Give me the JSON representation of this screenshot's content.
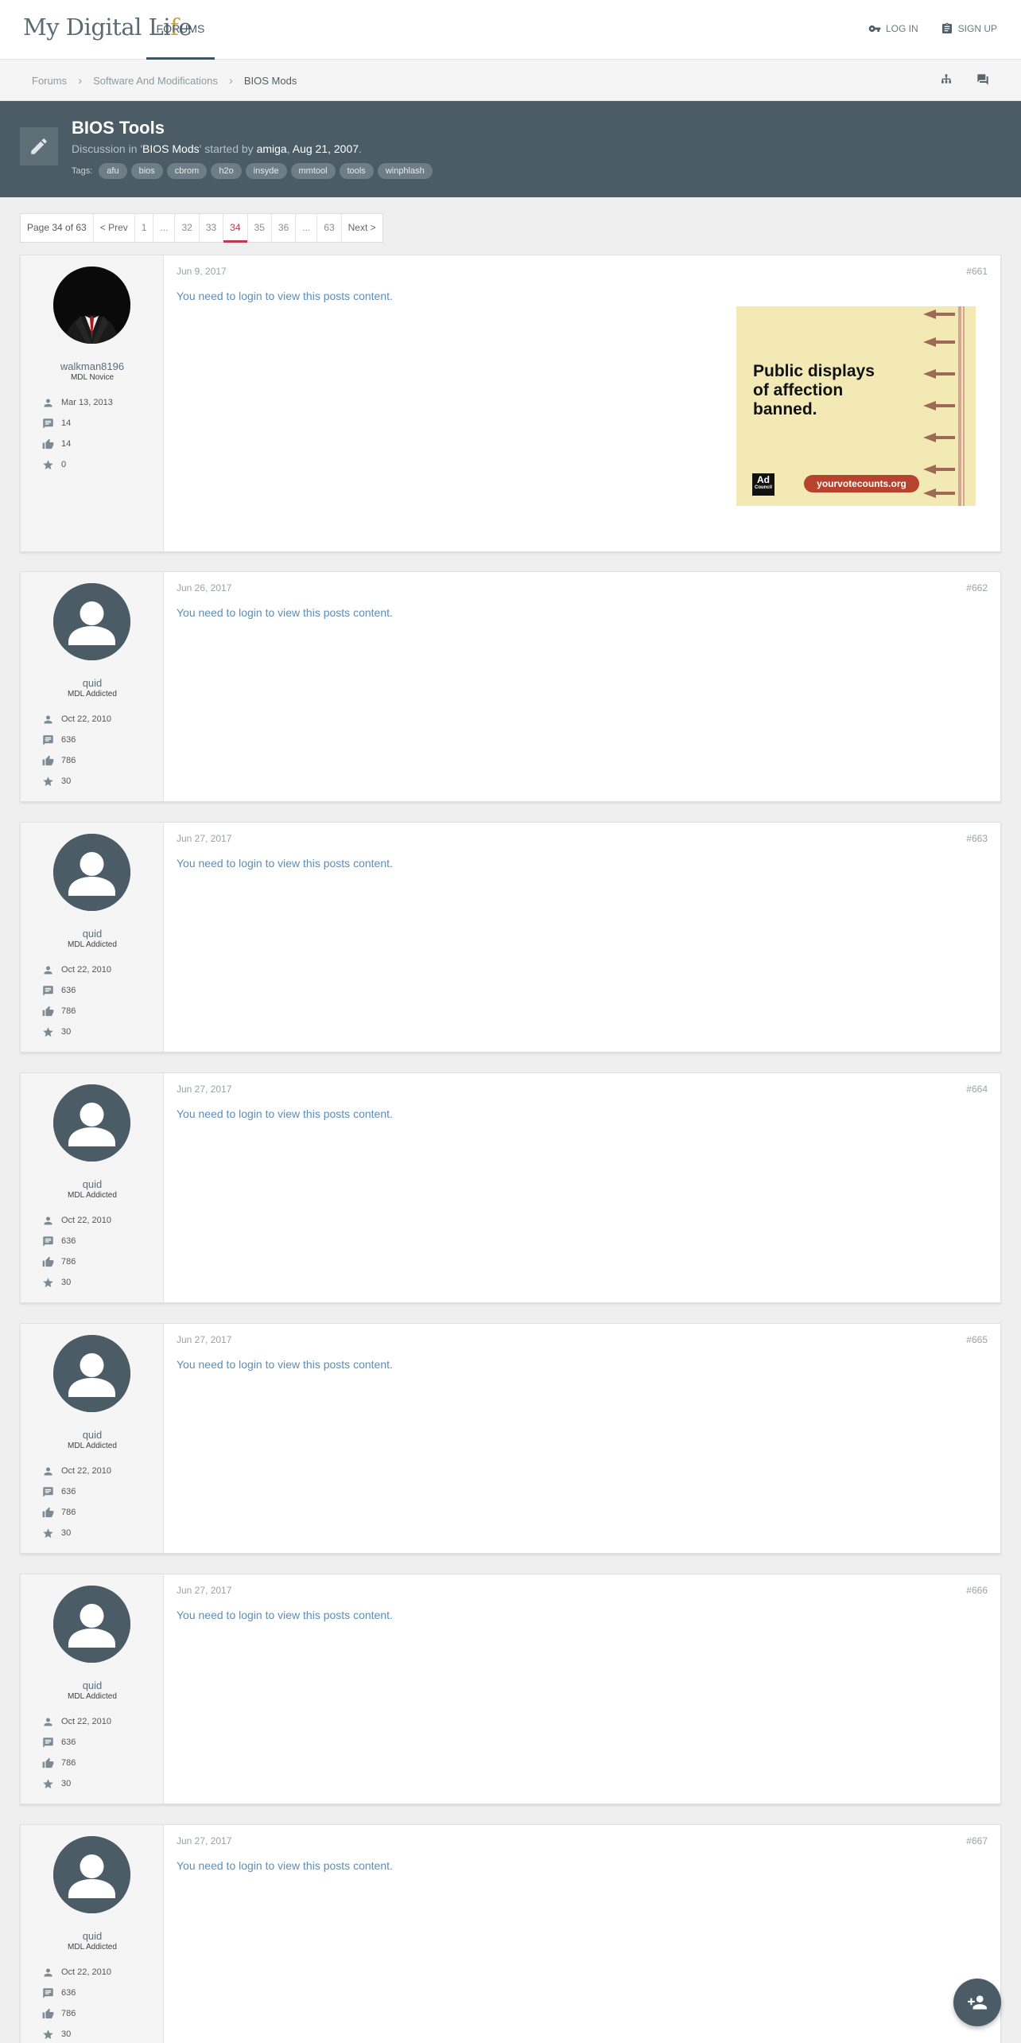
{
  "header": {
    "logo": {
      "prefix": "My Digital Li",
      "accent": "f",
      "suffix": "e"
    },
    "nav_forums": "FORUMS",
    "login_label": "LOG IN",
    "signup_label": "SIGN UP"
  },
  "breadcrumb": {
    "items": [
      "Forums",
      "Software And Modifications",
      "BIOS Mods"
    ]
  },
  "thread": {
    "title": "BIOS Tools",
    "sub_prefix": "Discussion in '",
    "forum": "BIOS Mods",
    "sub_mid": "' started by ",
    "author": "amiga",
    "sub_sep": ", ",
    "date": "Aug 21, 2007",
    "sub_end": ".",
    "tags_label": "Tags:",
    "tags": [
      "afu",
      "bios",
      "cbrom",
      "h2o",
      "insyde",
      "mmtool",
      "tools",
      "winphlash"
    ]
  },
  "pagination": {
    "label": "Page 34 of 63",
    "prev": "< Prev",
    "pages": [
      "1",
      "...",
      "32",
      "33",
      "34",
      "35",
      "36",
      "...",
      "63"
    ],
    "current": "34",
    "next": "Next >"
  },
  "login_message": "You need to login to view this posts content.",
  "posts": [
    {
      "user": "walkman8196",
      "rank": "MDL Novice",
      "joined": "Mar 13, 2013",
      "messages": "14",
      "likes": "14",
      "points": "0",
      "date": "Jun 9, 2017",
      "num": "#661"
    },
    {
      "user": "quid",
      "rank": "MDL Addicted",
      "joined": "Oct 22, 2010",
      "messages": "636",
      "likes": "786",
      "points": "30",
      "date": "Jun 26, 2017",
      "num": "#662"
    },
    {
      "user": "quid",
      "rank": "MDL Addicted",
      "joined": "Oct 22, 2010",
      "messages": "636",
      "likes": "786",
      "points": "30",
      "date": "Jun 27, 2017",
      "num": "#663"
    },
    {
      "user": "quid",
      "rank": "MDL Addicted",
      "joined": "Oct 22, 2010",
      "messages": "636",
      "likes": "786",
      "points": "30",
      "date": "Jun 27, 2017",
      "num": "#664"
    },
    {
      "user": "quid",
      "rank": "MDL Addicted",
      "joined": "Oct 22, 2010",
      "messages": "636",
      "likes": "786",
      "points": "30",
      "date": "Jun 27, 2017",
      "num": "#665"
    },
    {
      "user": "quid",
      "rank": "MDL Addicted",
      "joined": "Oct 22, 2010",
      "messages": "636",
      "likes": "786",
      "points": "30",
      "date": "Jun 27, 2017",
      "num": "#666"
    },
    {
      "user": "quid",
      "rank": "MDL Addicted",
      "joined": "Oct 22, 2010",
      "messages": "636",
      "likes": "786",
      "points": "30",
      "date": "Jun 27, 2017",
      "num": "#667"
    }
  ],
  "ad": {
    "headline_1": "Public displays",
    "headline_2": "of affection",
    "headline_3": "banned.",
    "logo_text": "Ad",
    "logo_sub": "Council",
    "url": "yourvotecounts.org"
  },
  "icons": {
    "login": "key-icon",
    "signup": "clipboard-icon",
    "sitemap": "sitemap-icon",
    "chat": "chat-icon",
    "thread": "pen-icon",
    "joined": "person-icon",
    "messages": "message-icon",
    "likes": "thumbs-up-icon",
    "points": "star-icon",
    "fab": "add-user-icon"
  },
  "colors": {
    "header_bg": "#4b5c66",
    "accent": "#c0394b",
    "link": "#5d8db8",
    "logo_accent": "#c9a23a"
  }
}
